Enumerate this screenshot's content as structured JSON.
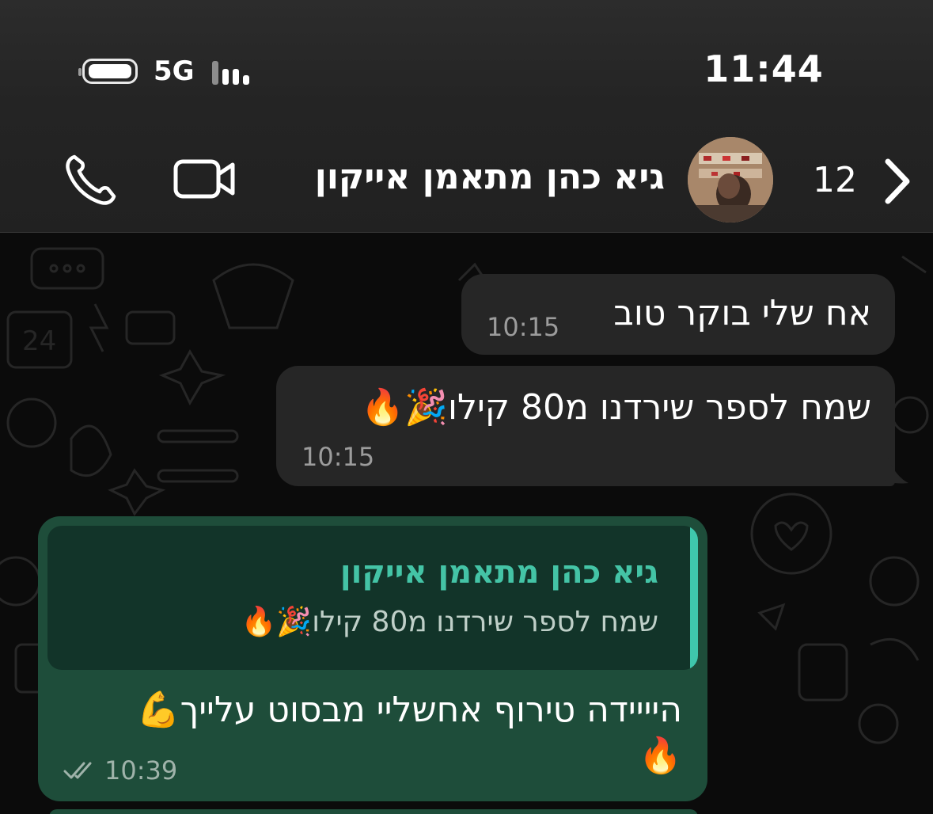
{
  "status_bar": {
    "time": "11:44",
    "network": "5G"
  },
  "header": {
    "back_count": "12",
    "contact_name": "גיא כהן מתאמן אייקון",
    "icons": [
      "chevron-left-icon",
      "avatar",
      "video-camera-icon",
      "phone-icon"
    ]
  },
  "messages": [
    {
      "direction": "incoming",
      "text": "אח שלי בוקר טוב",
      "time": "10:15"
    },
    {
      "direction": "incoming",
      "text": "שמח לספר שירדנו מ80 קילו🎉🔥",
      "time": "10:15"
    },
    {
      "direction": "outgoing",
      "quote": {
        "author": "גיא כהן מתאמן אייקון",
        "text": "שמח לספר שירדנו מ80 קילו🎉🔥"
      },
      "text": "היייידה טירוף אחשליי מבסוט עלייך💪",
      "text_line2": "🔥",
      "time": "10:39",
      "status": "read"
    }
  ],
  "colors": {
    "header_bg": "#242424",
    "chat_bg": "#0b0b0b",
    "incoming_bubble": "#262626",
    "outgoing_bubble": "#1e4d3a",
    "quote_accent": "#3fc7ac"
  }
}
